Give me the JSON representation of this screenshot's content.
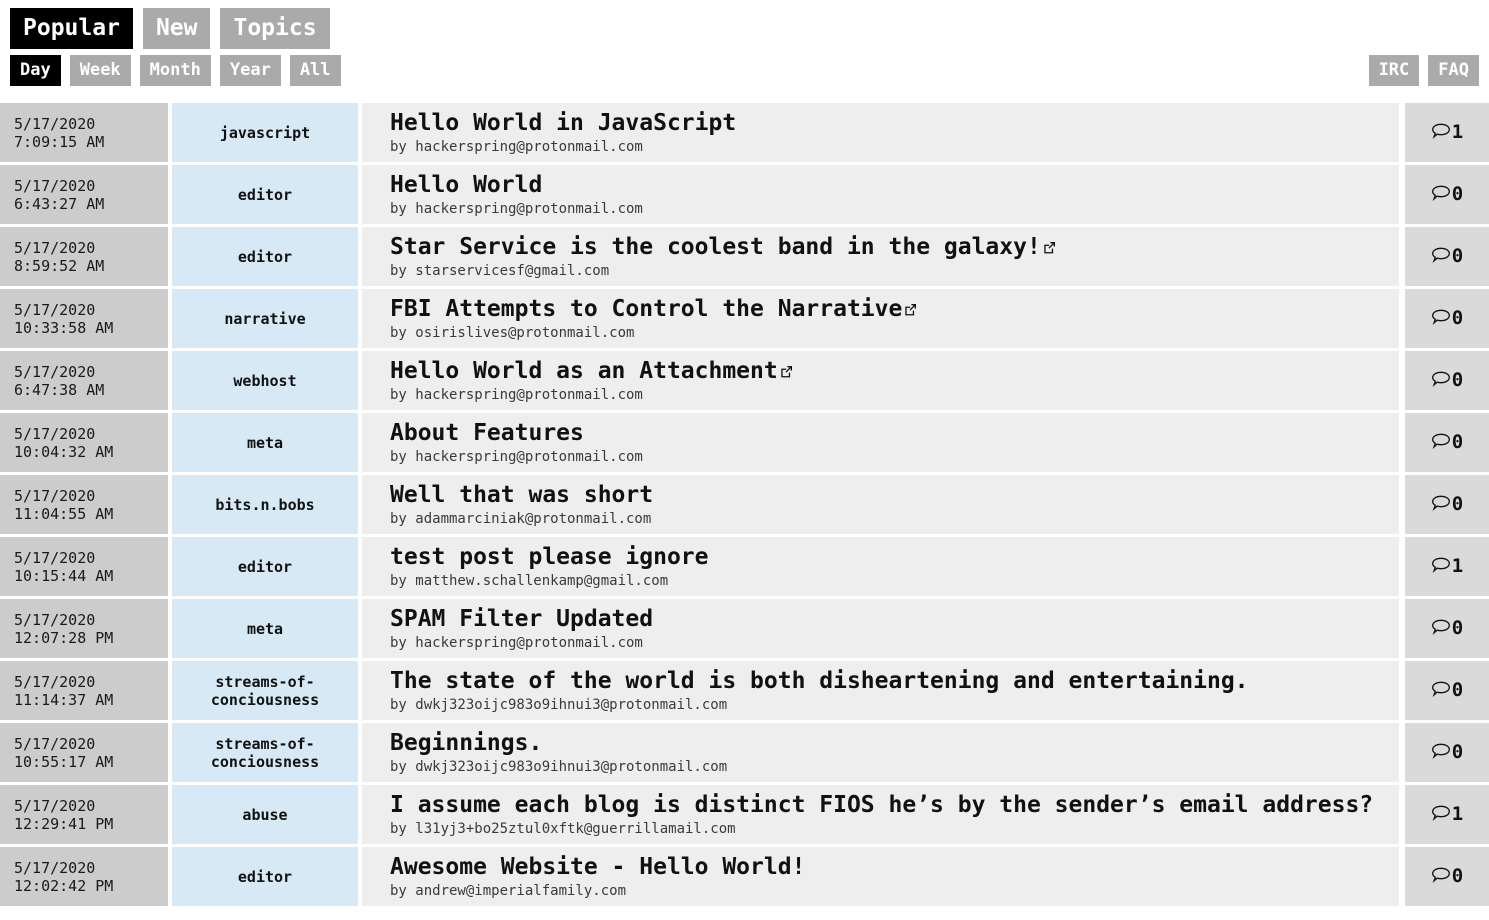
{
  "nav": {
    "primary": [
      {
        "label": "Popular",
        "active": true
      },
      {
        "label": "New",
        "active": false
      },
      {
        "label": "Topics",
        "active": false
      }
    ],
    "secondary": [
      {
        "label": "Day",
        "active": true
      },
      {
        "label": "Week",
        "active": false
      },
      {
        "label": "Month",
        "active": false
      },
      {
        "label": "Year",
        "active": false
      },
      {
        "label": "All",
        "active": false
      }
    ],
    "right": [
      {
        "label": "IRC",
        "active": false
      },
      {
        "label": "FAQ",
        "active": false
      }
    ]
  },
  "colors": {
    "active_button_bg": "#000000",
    "button_bg": "#aaaaaa",
    "button_text": "#ffffff",
    "date_cell_bg": "#cccccc",
    "tag_cell_bg": "#d6e9f5",
    "main_cell_bg": "#eeeeee",
    "comment_cell_bg": "#dadada",
    "page_bg": "#ffffff"
  },
  "icons": {
    "external_link": "external-link-icon",
    "comment": "comment-bubble-icon"
  },
  "posts": [
    {
      "date": "5/17/2020",
      "time": "7:09:15 AM",
      "tag": "javascript",
      "title": "Hello World in JavaScript",
      "external": false,
      "by": "by hackerspring@protonmail.com",
      "comments": "1"
    },
    {
      "date": "5/17/2020",
      "time": "6:43:27 AM",
      "tag": "editor",
      "title": "Hello World",
      "external": false,
      "by": "by hackerspring@protonmail.com",
      "comments": "0"
    },
    {
      "date": "5/17/2020",
      "time": "8:59:52 AM",
      "tag": "editor",
      "title": "Star Service is the coolest band in the galaxy!",
      "external": true,
      "by": "by starservicesf@gmail.com",
      "comments": "0"
    },
    {
      "date": "5/17/2020",
      "time": "10:33:58 AM",
      "tag": "narrative",
      "title": "FBI Attempts to Control the Narrative",
      "external": true,
      "by": "by osirislives@protonmail.com",
      "comments": "0"
    },
    {
      "date": "5/17/2020",
      "time": "6:47:38 AM",
      "tag": "webhost",
      "title": "Hello World as an Attachment",
      "external": true,
      "by": "by hackerspring@protonmail.com",
      "comments": "0"
    },
    {
      "date": "5/17/2020",
      "time": "10:04:32 AM",
      "tag": "meta",
      "title": "About Features",
      "external": false,
      "by": "by hackerspring@protonmail.com",
      "comments": "0"
    },
    {
      "date": "5/17/2020",
      "time": "11:04:55 AM",
      "tag": "bits.n.bobs",
      "title": "Well that was short",
      "external": false,
      "by": "by adammarciniak@protonmail.com",
      "comments": "0"
    },
    {
      "date": "5/17/2020",
      "time": "10:15:44 AM",
      "tag": "editor",
      "title": "test post please ignore",
      "external": false,
      "by": "by matthew.schallenkamp@gmail.com",
      "comments": "1"
    },
    {
      "date": "5/17/2020",
      "time": "12:07:28 PM",
      "tag": "meta",
      "title": "SPAM Filter Updated",
      "external": false,
      "by": "by hackerspring@protonmail.com",
      "comments": "0"
    },
    {
      "date": "5/17/2020",
      "time": "11:14:37 AM",
      "tag": "streams-of-conciousness",
      "title": "The state of the world is both disheartening and entertaining.",
      "external": false,
      "by": "by dwkj323oijc983o9ihnui3@protonmail.com",
      "comments": "0"
    },
    {
      "date": "5/17/2020",
      "time": "10:55:17 AM",
      "tag": "streams-of-conciousness",
      "title": "Beginnings.",
      "external": false,
      "by": "by dwkj323oijc983o9ihnui3@protonmail.com",
      "comments": "0"
    },
    {
      "date": "5/17/2020",
      "time": "12:29:41 PM",
      "tag": "abuse",
      "title": "I assume each blog is distinct FIOS he’s by the sender’s email address?",
      "external": false,
      "by": "by l31yj3+bo25ztul0xftk@guerrillamail.com",
      "comments": "1"
    },
    {
      "date": "5/17/2020",
      "time": "12:02:42 PM",
      "tag": "editor",
      "title": "Awesome Website - Hello World!",
      "external": false,
      "by": "by andrew@imperialfamily.com",
      "comments": "0"
    }
  ]
}
